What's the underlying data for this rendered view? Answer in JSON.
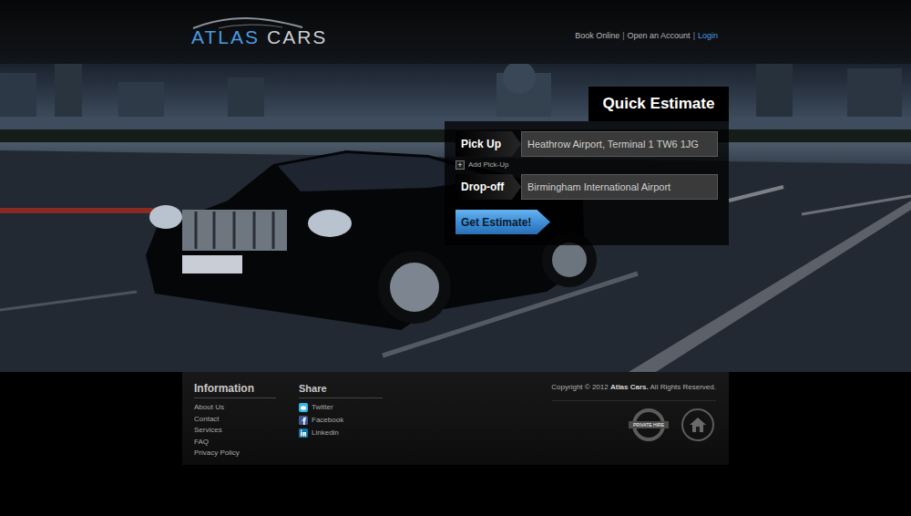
{
  "logo": {
    "brand": "ATLAS",
    "suffix": "CARS"
  },
  "top_links": [
    {
      "label": "Book Online",
      "selected": false
    },
    {
      "label": "Open an Account",
      "selected": false
    },
    {
      "label": "Login",
      "selected": true
    }
  ],
  "top_links_separator": "|",
  "estimate": {
    "title": "Quick Estimate",
    "pickup": {
      "label": "Pick Up",
      "value": "Heathrow Airport, Terminal 1 TW6 1JG"
    },
    "add_pickup": {
      "icon": "+",
      "label": "Add Pick-Up"
    },
    "dropoff": {
      "label": "Drop-off",
      "value": "Birmingham International Airport"
    },
    "button": "Get Estimate!"
  },
  "footer": {
    "information": {
      "title": "Information",
      "links": [
        "About Us",
        "Contact",
        "Services",
        "FAQ",
        "Privacy Policy"
      ]
    },
    "share": {
      "title": "Share",
      "links": [
        {
          "label": "Twitter",
          "kind": "twitter"
        },
        {
          "label": "Facebook",
          "kind": "facebook"
        },
        {
          "label": "Linkedin",
          "kind": "linkedin"
        }
      ]
    },
    "copyright": {
      "prefix": "Copyright © 2012 ",
      "brand": "Atlas Cars.",
      "suffix": " All Rights Reserved."
    },
    "badge": "PRIVATE HIRE"
  }
}
